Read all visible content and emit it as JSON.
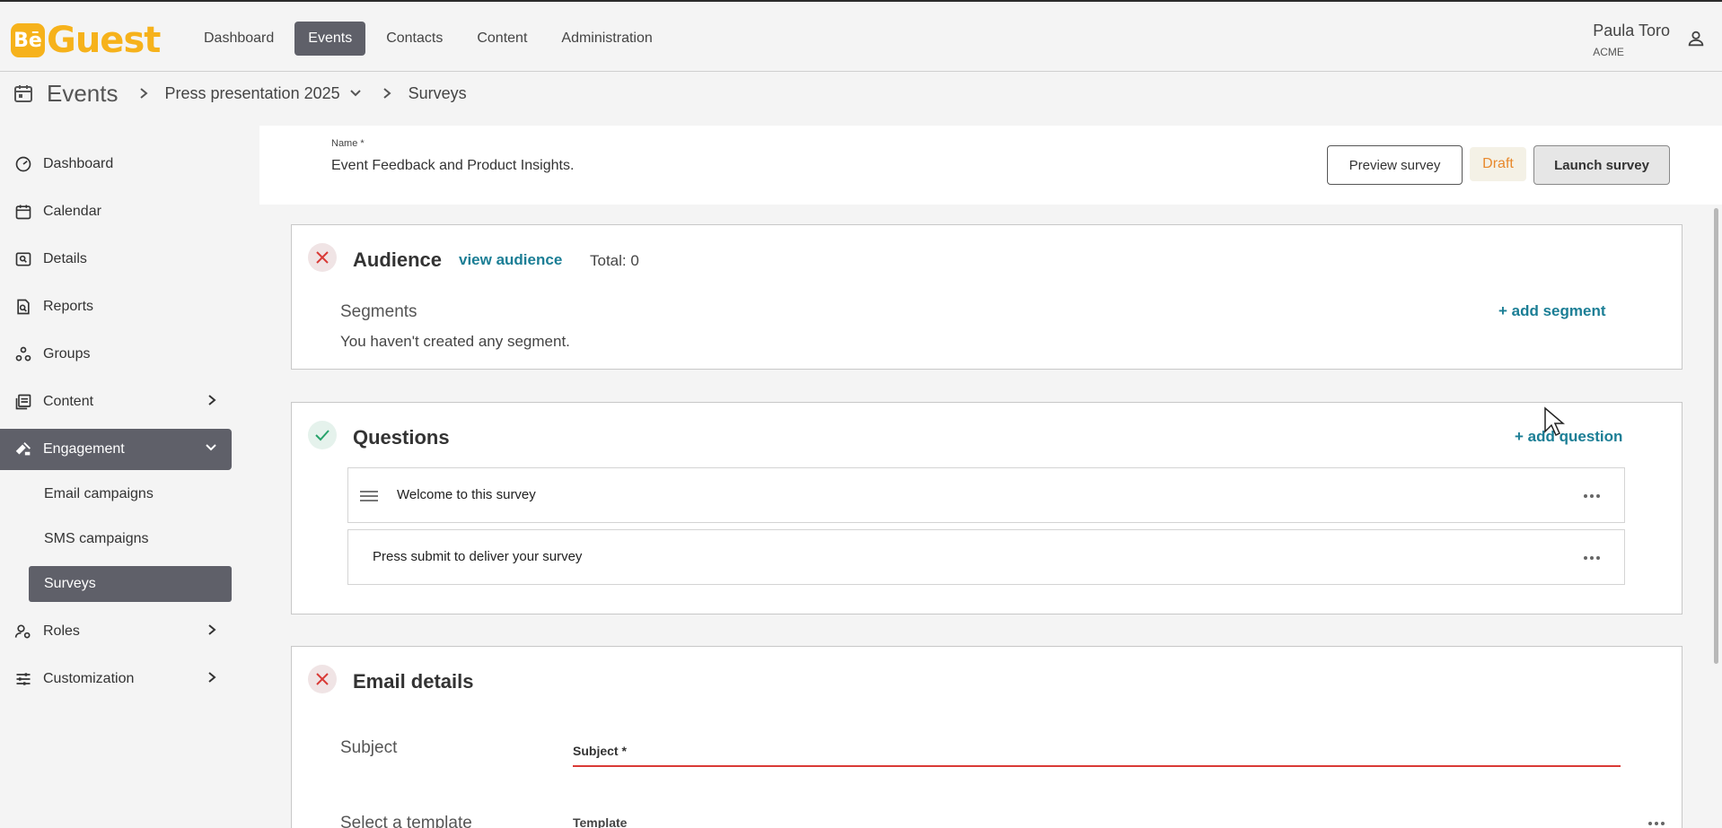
{
  "logo": {
    "badge": "Bē",
    "text": "Guest"
  },
  "topnav": [
    {
      "label": "Dashboard",
      "active": false
    },
    {
      "label": "Events",
      "active": true
    },
    {
      "label": "Contacts",
      "active": false
    },
    {
      "label": "Content",
      "active": false
    },
    {
      "label": "Administration",
      "active": false
    }
  ],
  "user": {
    "name": "Paula Toro",
    "org": "ACME"
  },
  "breadcrumb": {
    "section": "Events",
    "event": "Press presentation 2025",
    "page": "Surveys"
  },
  "sidebar": {
    "items": [
      {
        "label": "Dashboard",
        "icon": "dashboard-icon"
      },
      {
        "label": "Calendar",
        "icon": "calendar-icon"
      },
      {
        "label": "Details",
        "icon": "details-icon"
      },
      {
        "label": "Reports",
        "icon": "reports-icon"
      },
      {
        "label": "Groups",
        "icon": "groups-icon"
      },
      {
        "label": "Content",
        "icon": "content-icon"
      },
      {
        "label": "Engagement",
        "icon": "engagement-icon"
      },
      {
        "label": "Roles",
        "icon": "roles-icon"
      },
      {
        "label": "Customization",
        "icon": "customization-icon"
      }
    ],
    "engagement_sub": [
      {
        "label": "Email campaigns"
      },
      {
        "label": "SMS campaigns"
      },
      {
        "label": "Surveys"
      }
    ]
  },
  "survey": {
    "name_label": "Name *",
    "name_value": "Event Feedback and Product Insights.",
    "preview_label": "Preview survey",
    "status": "Draft",
    "launch_label": "Launch survey"
  },
  "audience": {
    "title": "Audience",
    "view_link": "view audience",
    "total": "Total: 0",
    "segments_label": "Segments",
    "add_segment": "+ add segment",
    "empty_text": "You haven't created any segment."
  },
  "questions": {
    "title": "Questions",
    "add_question": "+ add question",
    "items": [
      {
        "text": "Welcome to this survey"
      },
      {
        "text": "Press submit to deliver your survey"
      }
    ]
  },
  "email_details": {
    "title": "Email details",
    "subject_label": "Subject",
    "subject_field_label": "Subject *",
    "template_label": "Select a template",
    "template_field_label": "Template"
  },
  "colors": {
    "accent": "#1b7e95",
    "brand": "#f6b21b",
    "active_nav": "#5f6069",
    "error": "#d93a36",
    "draft": "#e8892c"
  }
}
